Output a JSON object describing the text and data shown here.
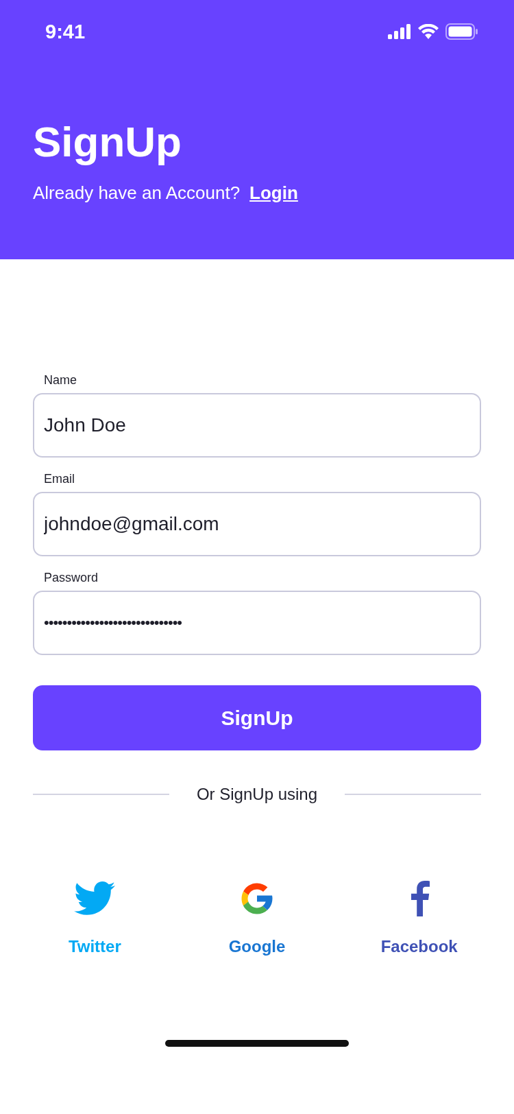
{
  "status_bar": {
    "time": "9:41"
  },
  "header": {
    "title": "SignUp",
    "prompt": "Already have an Account?",
    "link": "Login"
  },
  "fields": [
    {
      "kind": "text",
      "label": "Name",
      "value": "John Doe"
    },
    {
      "kind": "text",
      "label": "Email",
      "value": "johndoe@gmail.com"
    },
    {
      "kind": "password",
      "label": "Password",
      "value": "••••••••••••••••••••••••••••••"
    }
  ],
  "submit_button": "SignUp",
  "divider_text": "Or SignUp using",
  "social": [
    {
      "kind": "twitter",
      "label": "Twitter",
      "color": "#03a9f4"
    },
    {
      "kind": "google",
      "label": "Google",
      "color": "#1976d2"
    },
    {
      "kind": "facebook",
      "label": "Facebook",
      "color": "#3f51b5"
    }
  ]
}
